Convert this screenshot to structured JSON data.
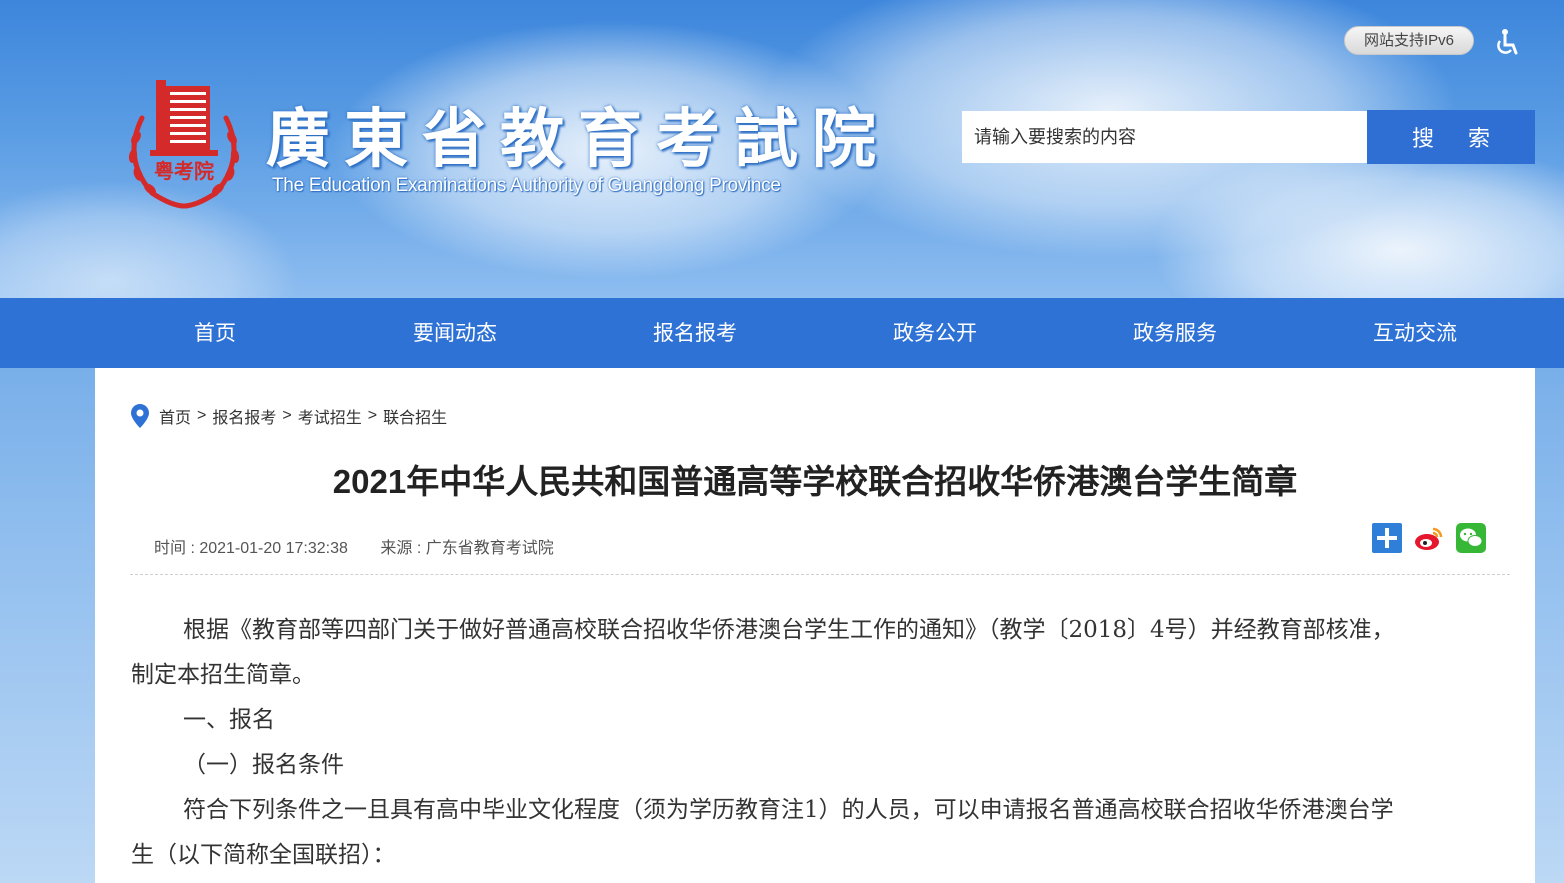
{
  "header": {
    "title_cn": "廣東省教育考試院",
    "title_en": "The Education Examinations Authority of Guangdong Province",
    "logo_text": "粤考院",
    "ipv6_label": "网站支持IPv6",
    "search_placeholder": "请输入要搜索的内容",
    "search_button": "搜 索"
  },
  "nav": {
    "items": [
      "首页",
      "要闻动态",
      "报名报考",
      "政务公开",
      "政务服务",
      "互动交流"
    ]
  },
  "breadcrumb": {
    "items": [
      "首页",
      "报名报考",
      "考试招生",
      "联合招生"
    ],
    "separator": ">"
  },
  "article": {
    "title": "2021年中华人民共和国普通高等学校联合招收华侨港澳台学生简章",
    "time_label": "时间 : 2021-01-20 17:32:38",
    "source_label": "来源 : 广东省教育考试院",
    "paragraphs": [
      "根据《教育部等四部门关于做好普通高校联合招收华侨港澳台学生工作的通知》（教学〔2018〕4号）并经教育部核准，",
      "制定本招生简章。",
      "一、报名",
      "（一）报名条件",
      "符合下列条件之一且具有高中毕业文化程度（须为学历教育注1）的人员，可以申请报名普通高校联合招收华侨港澳台学",
      "生（以下简称全国联招）："
    ]
  },
  "share": {
    "icons": [
      "share-plus-icon",
      "weibo-icon",
      "wechat-icon"
    ]
  },
  "colors": {
    "nav_bg": "#2f72d6",
    "search_button_bg": "#2f6fd3",
    "logo_red": "#d42a2a"
  }
}
